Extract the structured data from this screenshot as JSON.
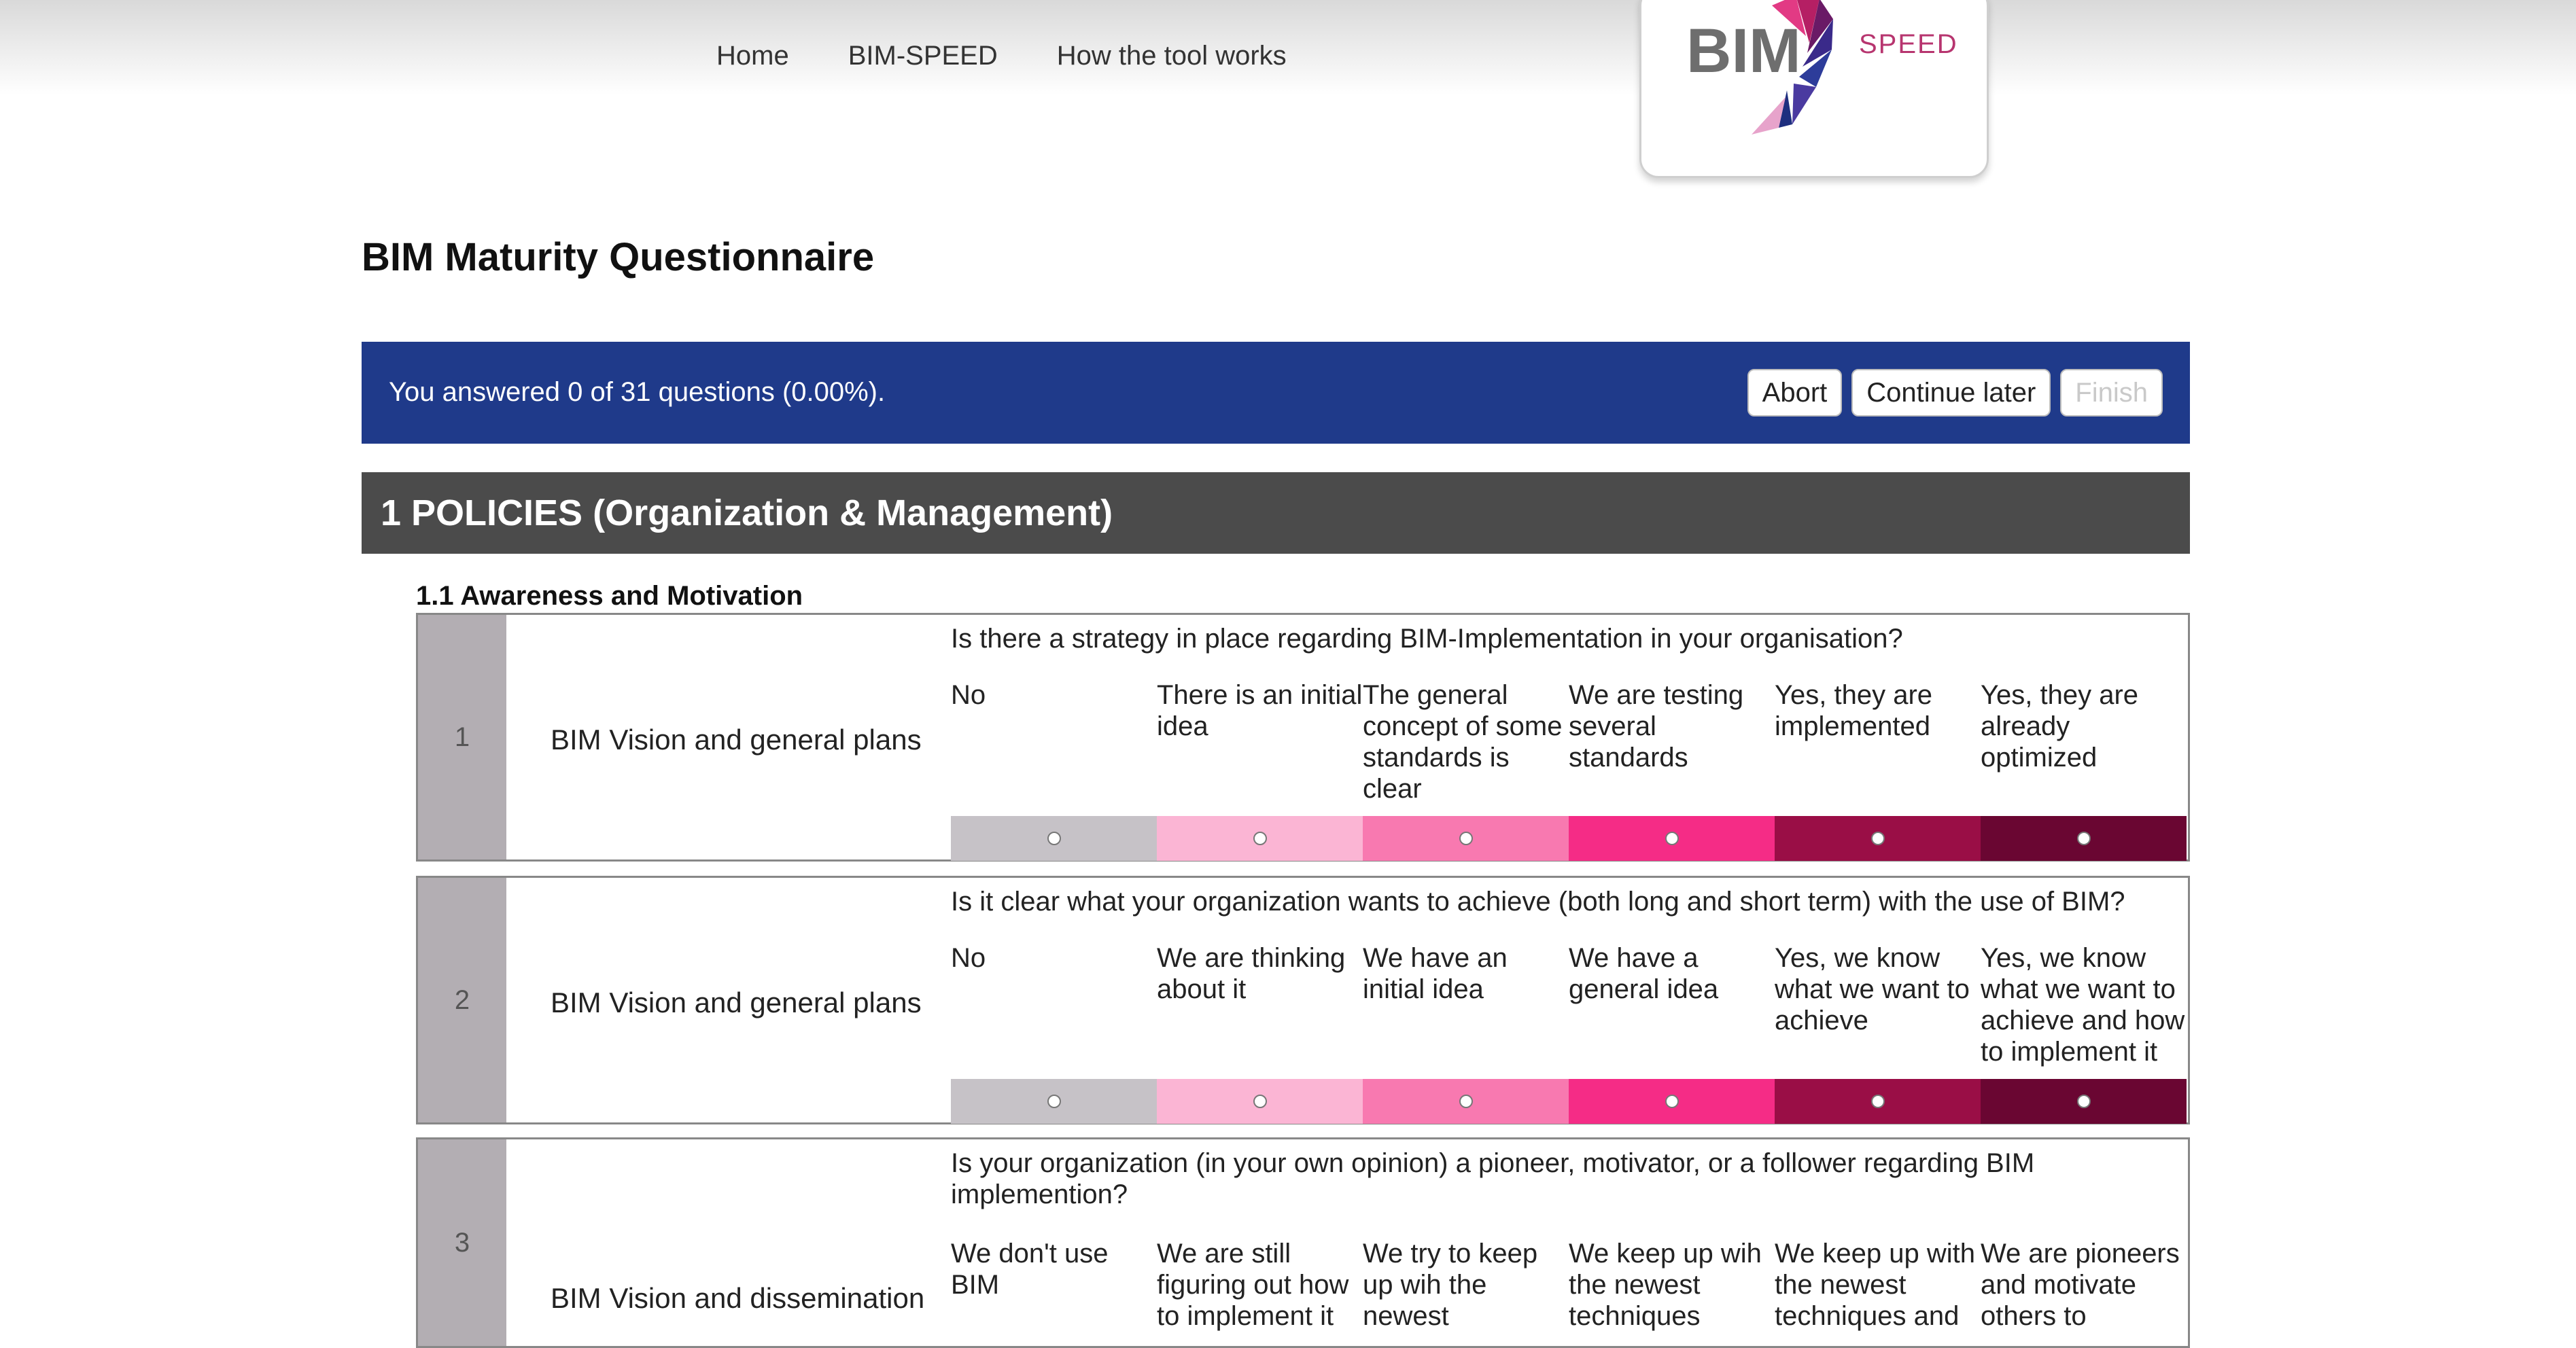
{
  "nav": {
    "items": [
      {
        "label": "Home"
      },
      {
        "label": "BIM-SPEED"
      },
      {
        "label": "How the tool works"
      }
    ]
  },
  "logo": {
    "bim": "BIM",
    "speed": "SPEED"
  },
  "page_title": "BIM Maturity Questionnaire",
  "progress": {
    "text": "You answered 0 of 31 questions (0.00%).",
    "answered": 0,
    "total": 31,
    "abort_label": "Abort",
    "continue_label": "Continue later",
    "finish_label": "Finish"
  },
  "section": {
    "title": "1 POLICIES (Organization & Management)",
    "subsection": "1.1 Awareness and Motivation"
  },
  "colors": {
    "header_blue": "#1f3a8a",
    "section_gray": "#4b4b4b",
    "scale": [
      "#c6c2c7",
      "#fbb5d4",
      "#f879b0",
      "#f52c86",
      "#9a0e46",
      "#6a0632"
    ]
  },
  "questions": [
    {
      "number": "1",
      "topic": "BIM Vision and general plans",
      "text": "Is there a strategy in place regarding BIM-Implementation in your organisation?",
      "options": [
        "No",
        "There is an initial idea",
        "The general concept of some standards is clear",
        "We are testing several standards",
        "Yes, they are implemented",
        "Yes, they are already optimized"
      ]
    },
    {
      "number": "2",
      "topic": "BIM Vision and general plans",
      "text": "Is it clear what your organization wants to achieve (both long and short term) with the use of BIM?",
      "options": [
        "No",
        "We are thinking about it",
        "We have an initial idea",
        "We have a general idea",
        "Yes, we know what we want to achieve",
        "Yes, we know what we want to achieve and how to implement it"
      ]
    },
    {
      "number": "3",
      "topic": "BIM Vision and dissemination",
      "text": "Is your organization (in your own opinion) a pioneer, motivator, or a follower regarding BIM implemention?",
      "options": [
        "We don't use BIM",
        "We are still figuring out how to implement it",
        "We try to keep up wih the newest",
        "We keep up wih the newest techniques",
        "We keep up with the newest techniques and",
        "We are pioneers and motivate others to"
      ]
    }
  ]
}
